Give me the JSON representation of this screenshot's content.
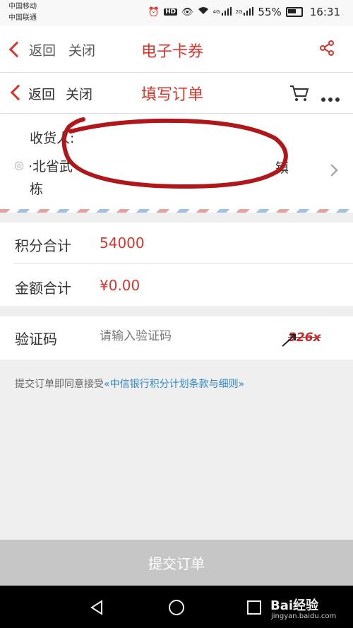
{
  "status_bar": {
    "carrier_1": "中国移动",
    "carrier_2": "中国联通",
    "hd_label": "HD",
    "net_1": "4G",
    "net_2": "2G",
    "battery": "55%",
    "time": "16:31",
    "icons": [
      "alarm-icon",
      "eye-icon",
      "wifi-icon",
      "signal-icon",
      "battery-icon"
    ]
  },
  "header_outer": {
    "back_label": "返回",
    "close_label": "关闭",
    "title": "电子卡券",
    "share_icon": "share-icon"
  },
  "header_inner": {
    "back_label": "返回",
    "close_label": "关闭",
    "title": "填写订单",
    "cart_icon": "cart-icon",
    "more_icon": "more-icon"
  },
  "address": {
    "recipient_label": "收货人:",
    "address_line_1": "·北省武",
    "address_line_1_tail": "镇",
    "address_line_2": "栋"
  },
  "points": {
    "label": "积分合计",
    "value": "54000"
  },
  "amount": {
    "label": "金额合计",
    "value": "¥0.00"
  },
  "verification": {
    "label": "验证码",
    "placeholder": "请输入验证码",
    "value": "",
    "captcha": "326x"
  },
  "terms": {
    "prefix": "提交订单即同意接受",
    "link": "«中信银行积分计划条款与细则»"
  },
  "submit_label": "提交订单",
  "watermark": {
    "brand": "Bai经验",
    "site": "jingyan.baidu.com"
  },
  "colors": {
    "accent": "#d6362c",
    "link": "#2f87c8",
    "submit_bg": "#c6c6c6",
    "annotation": "#b0171a"
  }
}
